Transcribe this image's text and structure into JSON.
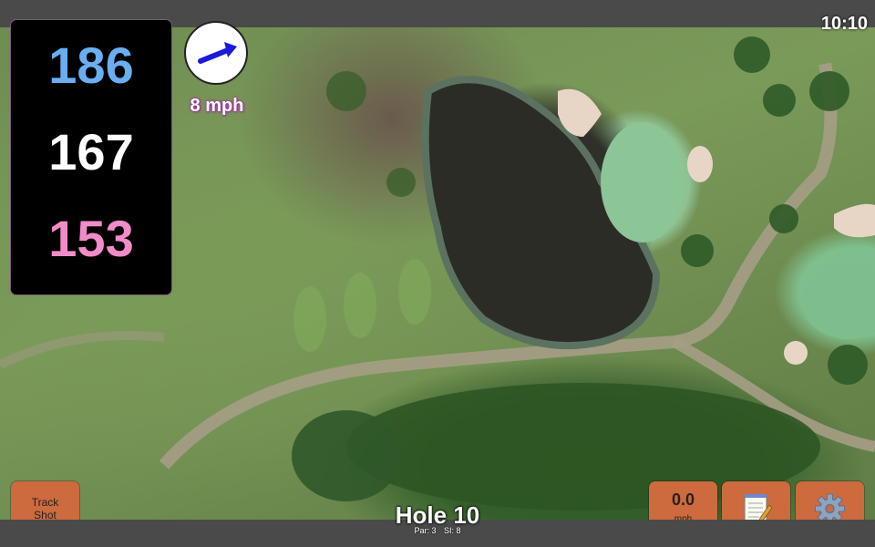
{
  "status": {
    "time": "10:10"
  },
  "distances": {
    "back": "186",
    "middle": "167",
    "front": "153"
  },
  "wind": {
    "speed_label": "8 mph",
    "icon": "wind-direction-arrow-icon",
    "arrow_color": "#1a1adc"
  },
  "track_button": {
    "label": "Track\nShot"
  },
  "speed_button": {
    "value": "0.0",
    "unit": "mph"
  },
  "notes_button": {
    "icon": "notepad-icon"
  },
  "settings_button": {
    "icon": "gear-icon"
  },
  "hole": {
    "title": "Hole 10",
    "par": "Par: 3",
    "si": "SI: 8"
  },
  "colors": {
    "back_distance": "#6aaef2",
    "middle_distance": "#ffffff",
    "front_distance": "#f28cc8",
    "button": "#cd6a3e",
    "wind_text_outline": "#a030a0"
  }
}
